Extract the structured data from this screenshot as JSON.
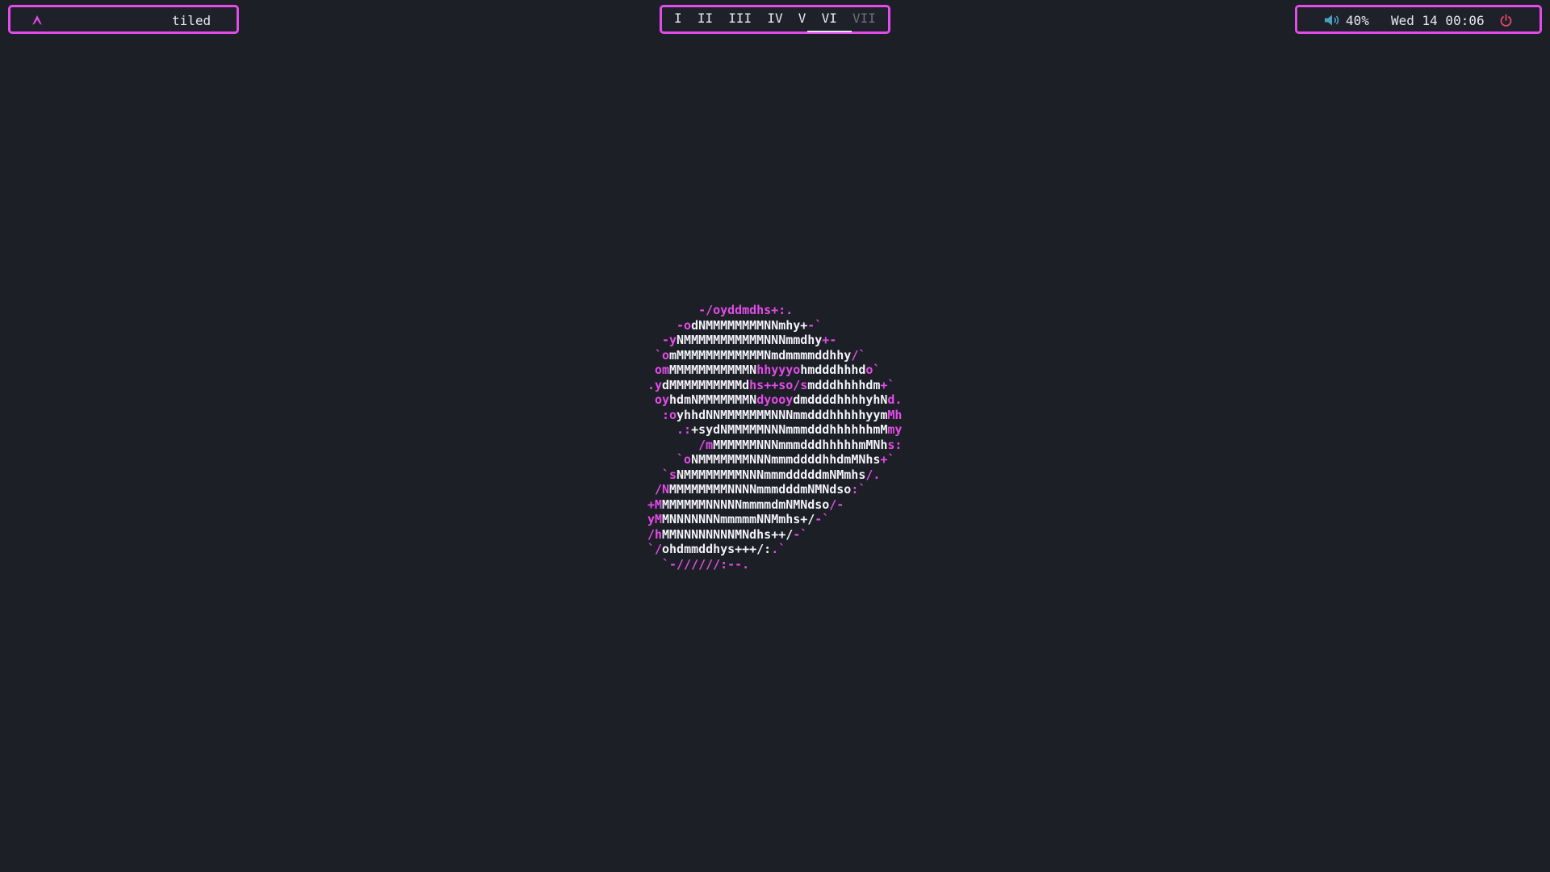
{
  "colors": {
    "background": "#1d1f27",
    "accent": "#e24ce8",
    "text": "#e8e8f0",
    "inactive": "#6d6f7e",
    "volume_icon": "#4a9ec0",
    "power_icon": "#e9446a"
  },
  "bar": {
    "left": {
      "launcher_icon": "arch-logo-icon",
      "layout": "tiled"
    },
    "workspaces": [
      {
        "label": "I",
        "state": "occupied"
      },
      {
        "label": "II",
        "state": "occupied"
      },
      {
        "label": "III",
        "state": "occupied"
      },
      {
        "label": "IV",
        "state": "occupied"
      },
      {
        "label": "V",
        "state": "occupied"
      },
      {
        "label": "VI",
        "state": "active"
      },
      {
        "label": "VII",
        "state": "empty"
      }
    ],
    "right": {
      "volume_icon": "speaker-icon",
      "volume": "40%",
      "datetime": "Wed 14 00:06",
      "power_icon": "power-icon"
    }
  },
  "desktop": {
    "ascii_logo": [
      [
        [
          "p",
          "       -/oyddmdhs+:."
        ]
      ],
      [
        [
          "p",
          "    -o"
        ],
        [
          "w",
          "dNMMMMMMMMNNmhy+"
        ],
        [
          "p",
          "-`"
        ]
      ],
      [
        [
          "p",
          "  -y"
        ],
        [
          "w",
          "NMMMMMMMMMMMNNNmmdhy"
        ],
        [
          "p",
          "+-"
        ]
      ],
      [
        [
          "p",
          " `o"
        ],
        [
          "w",
          "mMMMMMMMMMMMMNmdmmmmddhhy"
        ],
        [
          "p",
          "/`"
        ]
      ],
      [
        [
          "p",
          " om"
        ],
        [
          "w",
          "MMMMMMMMMMMN"
        ],
        [
          "p",
          "hhyyyo"
        ],
        [
          "w",
          "hmdddhhhd"
        ],
        [
          "p",
          "o`"
        ]
      ],
      [
        [
          "p",
          ".y"
        ],
        [
          "w",
          "dMMMMMMMMMMd"
        ],
        [
          "p",
          "hs++so/s"
        ],
        [
          "w",
          "mdddhhhhdm"
        ],
        [
          "p",
          "+`"
        ]
      ],
      [
        [
          "p",
          " oy"
        ],
        [
          "w",
          "hdmNMMMMMMMN"
        ],
        [
          "p",
          "dyooy"
        ],
        [
          "w",
          "dmddddhhhhyhN"
        ],
        [
          "p",
          "d."
        ]
      ],
      [
        [
          "p",
          "  :o"
        ],
        [
          "w",
          "yhhdNNMMMMMMMNNNmmdddhhhhhyym"
        ],
        [
          "p",
          "Mh"
        ]
      ],
      [
        [
          "p",
          "    .:"
        ],
        [
          "w",
          "+sydNMMMMMNNNmmmdddhhhhhhmM"
        ],
        [
          "p",
          "my"
        ]
      ],
      [
        [
          "p",
          "       /m"
        ],
        [
          "w",
          "MMMMMMNNNmmmdddhhhhhmMNh"
        ],
        [
          "p",
          "s:"
        ]
      ],
      [
        [
          "p",
          "    `o"
        ],
        [
          "w",
          "NMMMMMMMNNNmmmddddhhdmMNhs"
        ],
        [
          "p",
          "+`"
        ]
      ],
      [
        [
          "p",
          "  `s"
        ],
        [
          "w",
          "NMMMMMMMMNNNmmmdddddmNMmhs"
        ],
        [
          "p",
          "/."
        ]
      ],
      [
        [
          "p",
          " /N"
        ],
        [
          "w",
          "MMMMMMMMNNNNmmmdddmNMNdso"
        ],
        [
          "p",
          ":`"
        ]
      ],
      [
        [
          "p",
          "+M"
        ],
        [
          "w",
          "MMMMMMNNNNNmmmmdmNMNdso"
        ],
        [
          "p",
          "/-"
        ]
      ],
      [
        [
          "p",
          "yM"
        ],
        [
          "w",
          "MNNNNNNNmmmmmNNMmhs+/"
        ],
        [
          "p",
          "-`"
        ]
      ],
      [
        [
          "p",
          "/h"
        ],
        [
          "w",
          "MMNNNNNNNNMNdhs++/"
        ],
        [
          "p",
          "-`"
        ]
      ],
      [
        [
          "p",
          "`/"
        ],
        [
          "w",
          "ohdmmddhys+++/:"
        ],
        [
          "p",
          ".`"
        ]
      ],
      [
        [
          "p",
          "  `-//////:--."
        ]
      ]
    ]
  }
}
